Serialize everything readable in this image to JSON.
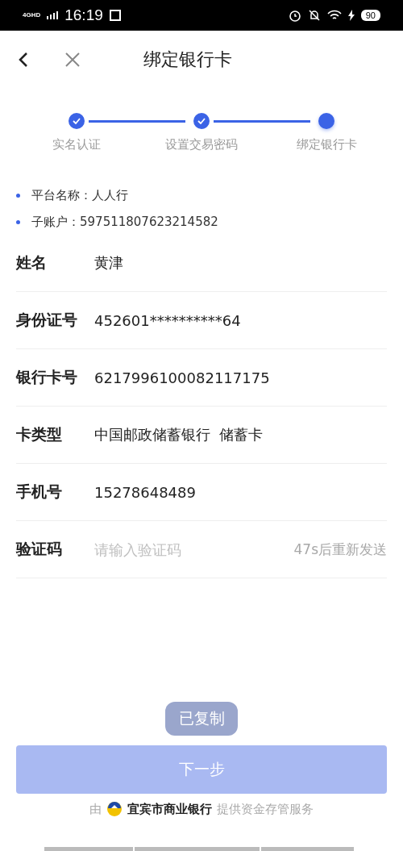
{
  "status_bar": {
    "network": "4GHD",
    "time": "16:19",
    "battery": "90"
  },
  "header": {
    "title": "绑定银行卡"
  },
  "steps": [
    {
      "label": "实名认证",
      "done": true
    },
    {
      "label": "设置交易密码",
      "done": true
    },
    {
      "label": "绑定银行卡",
      "done": false
    }
  ],
  "info": [
    "平台名称：人人行",
    "子账户：597511807623214582"
  ],
  "fields": [
    {
      "kind": "text",
      "label": "姓名",
      "value": "黄津"
    },
    {
      "kind": "text",
      "label": "身份证号",
      "value": "452601**********64"
    },
    {
      "kind": "text",
      "label": "银行卡号",
      "value": "6217996100082117175"
    },
    {
      "kind": "text",
      "label": "卡类型",
      "value": "中国邮政储蓄银行  储蓄卡"
    },
    {
      "kind": "text",
      "label": "手机号",
      "value": "15278648489"
    },
    {
      "kind": "input",
      "label": "验证码",
      "placeholder": "请输入验证码",
      "action": "47s后重新发送"
    }
  ],
  "next_button": {
    "label": "下一步",
    "disabled": true
  },
  "toast": "已复制",
  "footer": {
    "prefix": "由",
    "bank": "宜宾市商业银行",
    "suffix": "提供资金存管服务"
  }
}
